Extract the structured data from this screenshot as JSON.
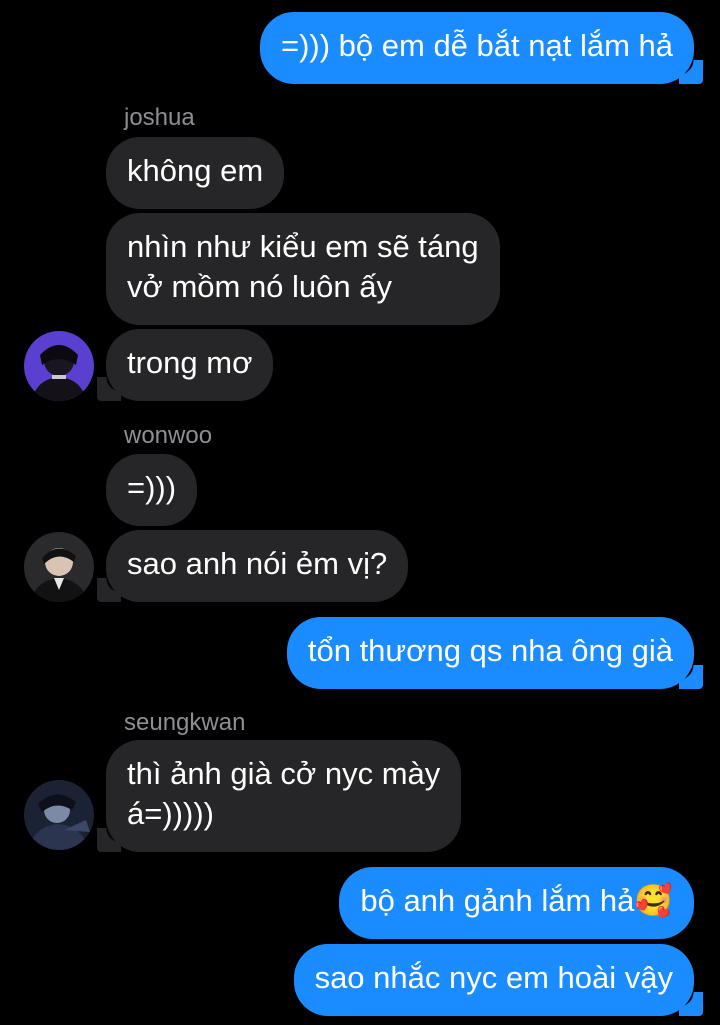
{
  "messages": [
    {
      "text": "=))) bộ em dễ bắt nạt lắm hả"
    },
    {
      "sender": "joshua"
    },
    {
      "text": "không em"
    },
    {
      "text": "nhìn như kiểu em sẽ táng vở mồm nó luôn ấy",
      "line1": "nhìn như kiểu em sẽ táng",
      "line2": "vở mồm nó luôn ấy"
    },
    {
      "text": "trong mơ"
    },
    {
      "sender": "wonwoo"
    },
    {
      "text": "=)))"
    },
    {
      "text": "sao anh nói ẻm vị?"
    },
    {
      "text": "tổn thương qs nha ông già"
    },
    {
      "sender": "seungkwan"
    },
    {
      "text": "thì ảnh già cở nyc mày á=)))))",
      "line1": "thì ảnh già cở nyc mày",
      "line2": "á=)))))"
    },
    {
      "text": "bộ anh gảnh lắm hả🥰"
    },
    {
      "text": "sao nhắc nyc em hoài vậy"
    }
  ],
  "avatars": [
    "avatar-joshua",
    "avatar-wonwoo",
    "avatar-seungkwan"
  ],
  "colors": {
    "background": "#000000",
    "outgoing_bubble": "#1a8cff",
    "incoming_bubble": "#262628",
    "sender_name": "#8e8e93",
    "text": "#ffffff"
  }
}
